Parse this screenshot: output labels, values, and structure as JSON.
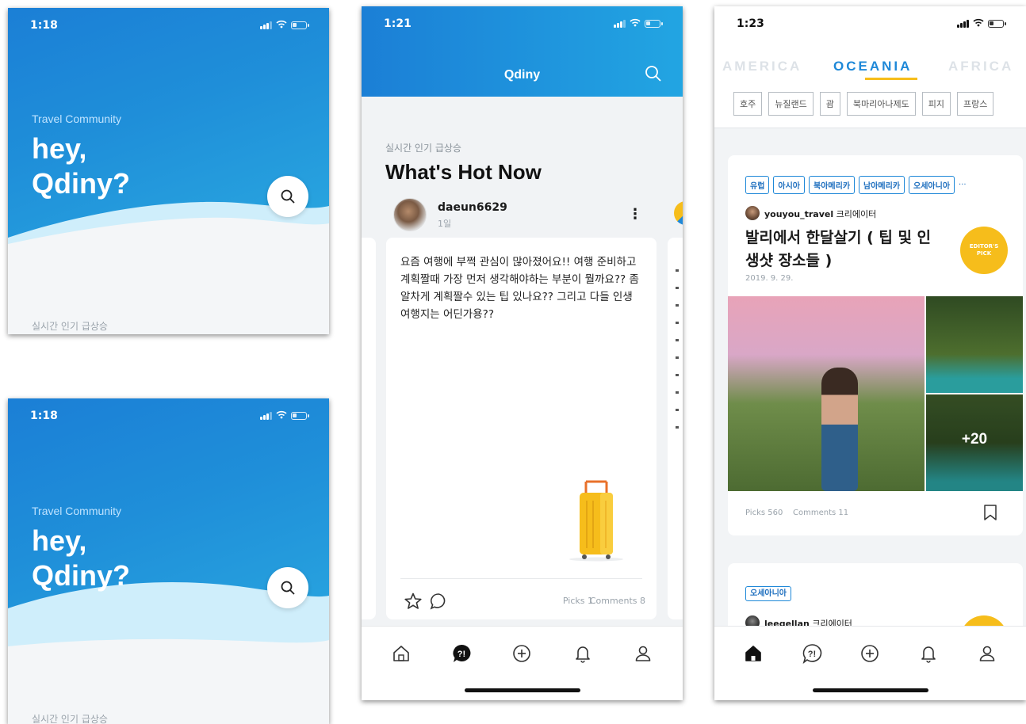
{
  "splash": {
    "time": "1:18",
    "travel_community": "Travel Community",
    "headline_line1": "hey,",
    "headline_line2": "Qdiny?",
    "bottom_label": "실시간 인기 급상승"
  },
  "feed": {
    "time": "1:21",
    "app_title": "Qdiny",
    "section_sub": "실시간 인기 급상승",
    "section_title": "What's Hot Now",
    "post": {
      "username": "daeun6629",
      "age": "1일",
      "more": "⋮",
      "body": "요즘 여행에 부쩍 관심이 많아졌어요!! 여행 준비하고 계획짤때 가장 먼저 생각해야하는 부분이 뭘까요?? 좀 알차게 계획짤수 있는 팁 있나요?? 그리고 다들 인생여행지는 어딘가용??",
      "picks": "Picks 1",
      "comments": "Comments 8"
    }
  },
  "browse": {
    "time": "1:23",
    "regions": [
      "AMERICA",
      "OCEANIA",
      "AFRICA"
    ],
    "active_region": "OCEANIA",
    "countries": [
      "호주",
      "뉴질랜드",
      "괌",
      "북마리아나제도",
      "피지",
      "프랑스"
    ],
    "card1": {
      "tags": [
        "유럽",
        "아시아",
        "북아메리카",
        "남아메리카",
        "오세아니아"
      ],
      "more_tags": "···",
      "author": "youyou_travel",
      "author_role": "크리에이터",
      "title_line1": "발리에서 한달살기 ( 팁 및 인",
      "title_line2": "생샷 장소들 )",
      "date": "2019. 9. 29.",
      "badge_line1": "EDITOR'S",
      "badge_line2": "PICK",
      "more_photos": "+20",
      "picks": "Picks 560",
      "comments": "Comments 11"
    },
    "card2": {
      "tag": "오세아니아",
      "author": "leegellan",
      "author_role": "크리에이터"
    }
  },
  "colors": {
    "brand_blue": "#1b7fd6",
    "accent_yellow": "#f6bd1b",
    "tag_blue": "#1e88d8"
  }
}
